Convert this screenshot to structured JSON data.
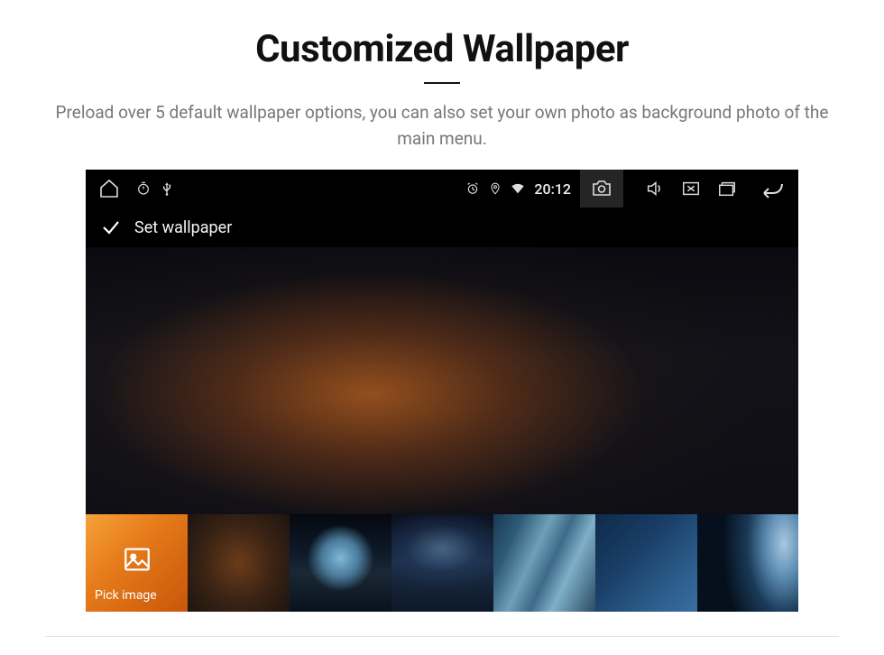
{
  "header": {
    "title": "Customized Wallpaper",
    "subtitle": "Preload over 5 default wallpaper options, you can also set your own photo as background photo of the main menu."
  },
  "statusbar": {
    "time": "20:12"
  },
  "actionbar": {
    "title": "Set wallpaper"
  },
  "thumbs": {
    "pick_label": "Pick image"
  }
}
